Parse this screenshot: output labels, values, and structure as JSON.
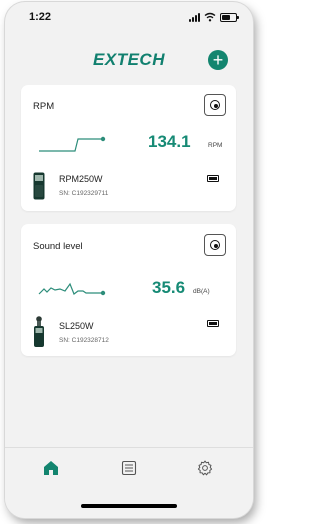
{
  "status": {
    "time": "1:22"
  },
  "header": {
    "logo": "EXTECH",
    "add_icon": "plus-icon"
  },
  "devices": [
    {
      "title": "RPM",
      "value": "134.1",
      "unit": "RPM",
      "device_name": "RPM250W",
      "serial": "SN: C192329711"
    },
    {
      "title": "Sound level",
      "value": "35.6",
      "unit": "dB(A)",
      "device_name": "SL250W",
      "serial": "SN: C192328712"
    }
  ],
  "tabbar": {
    "items": [
      "home-icon",
      "list-icon",
      "settings-icon"
    ],
    "active": "home-icon"
  },
  "colors": {
    "accent": "#13856f",
    "background": "#f2f2f2",
    "card": "#ffffff"
  }
}
